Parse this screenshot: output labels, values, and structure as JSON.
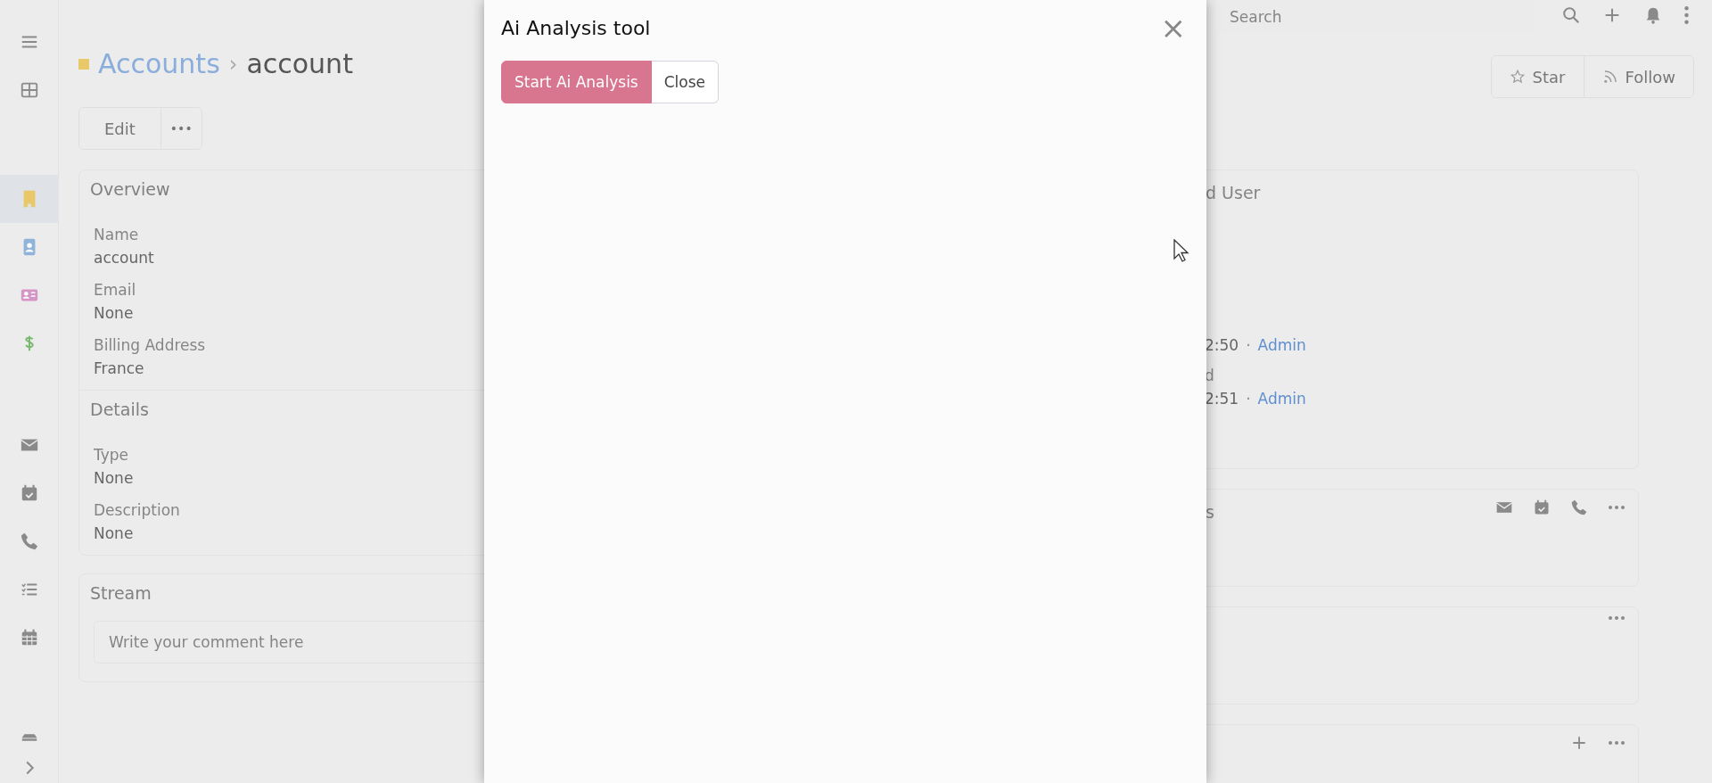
{
  "sidebar": {
    "items": [
      {
        "kind": "accounts",
        "selected": true,
        "color": "#e9c869"
      },
      {
        "kind": "contacts",
        "selected": false,
        "color": "#8fb3d9"
      },
      {
        "kind": "leads",
        "selected": false,
        "color": "#d596c7"
      },
      {
        "kind": "opportunities",
        "selected": false,
        "color": "#79b86f"
      }
    ]
  },
  "topbar": {
    "search": {
      "placeholder": "Search"
    }
  },
  "header": {
    "breadcrumb": {
      "parent": "Accounts",
      "separator": "›",
      "current": "account"
    },
    "actions": [
      "Edit",
      "•••"
    ],
    "side_actions": [
      "Star",
      "Follow"
    ]
  },
  "panels": [
    {
      "title": "Overview",
      "fields": [
        {
          "label": "Name",
          "value": "account"
        },
        {
          "label": "Email",
          "value": "None"
        },
        {
          "label": "Billing Address",
          "value": "France"
        }
      ]
    },
    {
      "title": "Details",
      "fields": [
        {
          "label": "Type",
          "value": "None"
        },
        {
          "label": "Description",
          "value": "None"
        }
      ]
    }
  ],
  "stream": {
    "title": "Stream",
    "placeholder": "Write your comment here"
  },
  "side_panels": [
    {
      "title": "d User",
      "rows": [
        {
          "value": "2:50",
          "separator": "·",
          "user": "Admin"
        },
        {
          "label": "d",
          "value": "2:51",
          "separator": "·",
          "user": "Admin"
        }
      ]
    },
    {
      "title": "s",
      "kind": "activities"
    },
    {
      "kind": "menu"
    },
    {
      "kind": "list"
    }
  ],
  "modal": {
    "title": "Ai Analysis tool",
    "close": "×",
    "buttons": [
      {
        "label": "Start Ai Analysis",
        "kind": "primary"
      },
      {
        "label": "Close",
        "kind": "default"
      }
    ]
  }
}
